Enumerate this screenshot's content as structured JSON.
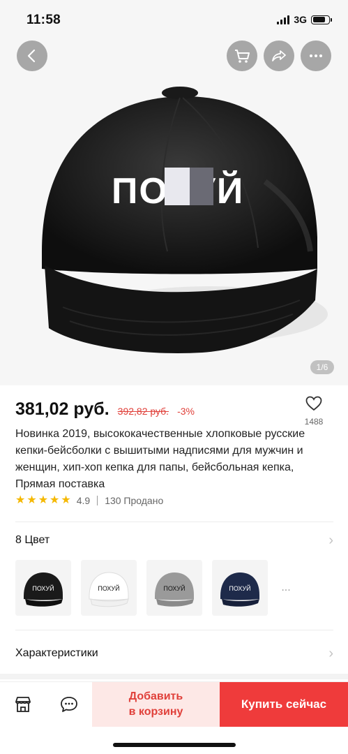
{
  "status_bar": {
    "time": "11:58",
    "network": "3G"
  },
  "gallery": {
    "counter": "1/6",
    "cap_text": "ПОХУЙ"
  },
  "product": {
    "price": "381,02 руб.",
    "old_price": "392,82 руб.",
    "discount": "-3%",
    "wishlist_count": "1488",
    "title": "Новинка 2019, высококачественные хлопковые русские кепки-бейсболки с вышитыми надписями для мужчин и женщин, хип-хоп кепка для папы, бейсбольная кепка, Прямая поставка",
    "rating_value": 4.9,
    "rating": "4.9",
    "sold": "130 Продано"
  },
  "colors": {
    "label": "8 Цвет",
    "more": "...",
    "swatches": [
      {
        "name": "black",
        "cap": "#1a1a1a",
        "text": "ПОХУЙ",
        "text_color": "#ffffff"
      },
      {
        "name": "white",
        "cap": "#f2f2f2",
        "text": "ПОХУЙ",
        "text_color": "#111111"
      },
      {
        "name": "gray",
        "cap": "#9a9a9a",
        "text": "ПОХУЙ",
        "text_color": "#111111"
      },
      {
        "name": "navy",
        "cap": "#1e2a4a",
        "text": "ПОХУЙ",
        "text_color": "#ffffff"
      }
    ]
  },
  "specs": {
    "label": "Характеристики"
  },
  "bottom_bar": {
    "add_to_cart_line1": "Добавить",
    "add_to_cart_line2": "в корзину",
    "buy_now": "Купить сейчас"
  },
  "theme": {
    "accent": "#ef3b3b",
    "accent_light": "#fde8e6",
    "star": "#f5b800"
  },
  "icons": {
    "back": "back-arrow-icon",
    "cart": "cart-icon",
    "share": "share-icon",
    "more": "more-icon",
    "heart": "heart-icon",
    "store": "store-icon",
    "chat": "chat-icon"
  }
}
